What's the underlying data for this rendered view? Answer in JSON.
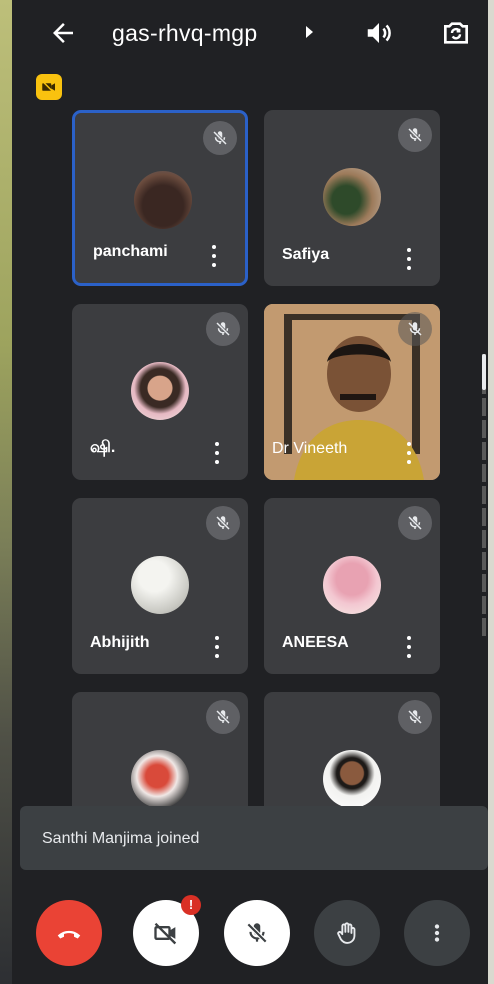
{
  "meeting": {
    "code": "gas-rhvq-mgp"
  },
  "participants": [
    {
      "name": "panchami",
      "muted": true,
      "active": true
    },
    {
      "name": "Safiya",
      "muted": true,
      "active": false
    },
    {
      "name": "ஷி.",
      "muted": true,
      "active": false
    },
    {
      "name": "Dr Vineeth",
      "muted": true,
      "active": false,
      "video_on": true
    },
    {
      "name": "Abhijith",
      "muted": true,
      "active": false
    },
    {
      "name": "ANEESA",
      "muted": true,
      "active": false
    },
    {
      "name": "",
      "muted": true,
      "active": false
    },
    {
      "name": "",
      "muted": true,
      "active": false
    }
  ],
  "toast": {
    "message": "Santhi Manjima joined"
  },
  "controls": {
    "camera_alert_badge": "!"
  },
  "icons": {
    "back": "arrow-left-icon",
    "speaker": "speaker-icon",
    "switch_camera": "switch-camera-icon",
    "camera_off_indicator": "camera-off-icon",
    "muted": "mic-off-icon",
    "options": "more-vert-icon",
    "end_call": "phone-hangup-icon",
    "camera": "video-off-icon",
    "mic": "mic-off-icon",
    "raise_hand": "hand-icon",
    "more": "more-vert-icon"
  },
  "colors": {
    "background": "#202124",
    "tile": "#3c3d40",
    "active_tile_border": "#2b61c8",
    "end_call": "#ea4335",
    "camera_off_badge": "#f9c20f",
    "alert_badge": "#d93025"
  }
}
